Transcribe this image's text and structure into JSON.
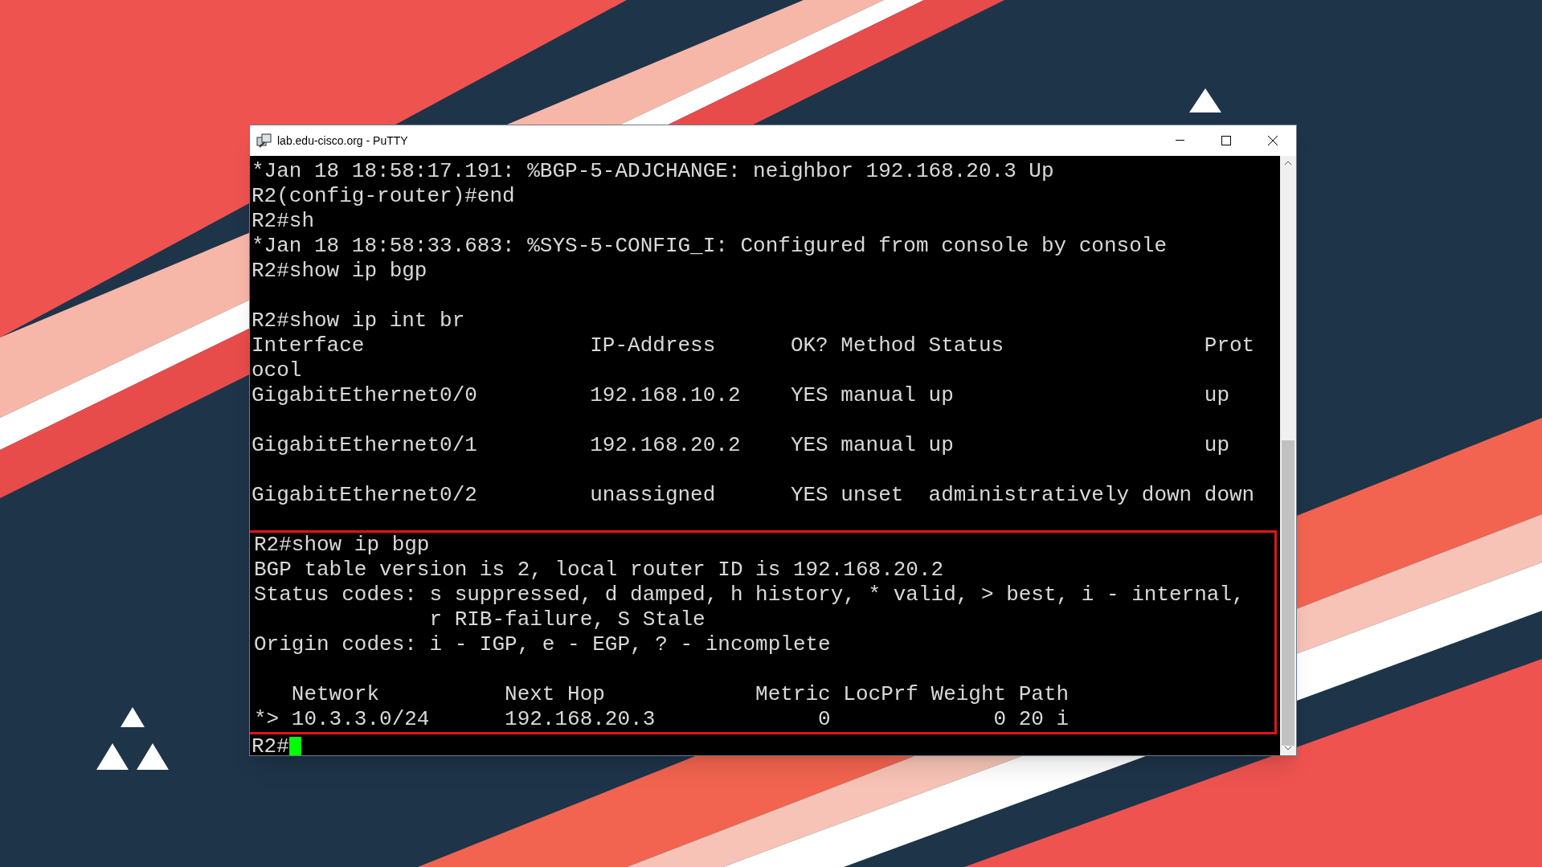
{
  "window": {
    "title": "lab.edu-cisco.org - PuTTY"
  },
  "terminal": {
    "lines": [
      {
        "kind": "text",
        "text": "*Jan 18 18:58:17.191: %BGP-5-ADJCHANGE: neighbor 192.168.20.3 Up"
      },
      {
        "kind": "text",
        "text": "R2(config-router)#end"
      },
      {
        "kind": "text",
        "text": "R2#sh"
      },
      {
        "kind": "text",
        "text": "*Jan 18 18:58:33.683: %SYS-5-CONFIG_I: Configured from console by console"
      },
      {
        "kind": "text",
        "text": "R2#show ip bgp"
      },
      {
        "kind": "blank"
      },
      {
        "kind": "text",
        "text": "R2#show ip int br"
      },
      {
        "kind": "text",
        "text": "Interface                  IP-Address      OK? Method Status                Prot"
      },
      {
        "kind": "text",
        "text": "ocol"
      },
      {
        "kind": "text",
        "text": "GigabitEthernet0/0         192.168.10.2    YES manual up                    up"
      },
      {
        "kind": "blank"
      },
      {
        "kind": "text",
        "text": "GigabitEthernet0/1         192.168.20.2    YES manual up                    up"
      },
      {
        "kind": "blank"
      },
      {
        "kind": "text",
        "text": "GigabitEthernet0/2         unassigned      YES unset  administratively down down"
      },
      {
        "kind": "blank"
      }
    ],
    "highlighted_lines": [
      {
        "kind": "text",
        "text": "R2#show ip bgp"
      },
      {
        "kind": "text",
        "text": "BGP table version is 2, local router ID is 192.168.20.2"
      },
      {
        "kind": "text",
        "text": "Status codes: s suppressed, d damped, h history, * valid, > best, i - internal,"
      },
      {
        "kind": "text",
        "text": "              r RIB-failure, S Stale"
      },
      {
        "kind": "text",
        "text": "Origin codes: i - IGP, e - EGP, ? - incomplete"
      },
      {
        "kind": "blank"
      },
      {
        "kind": "text",
        "text": "   Network          Next Hop            Metric LocPrf Weight Path"
      },
      {
        "kind": "text",
        "text": "*> 10.3.3.0/24      192.168.20.3             0             0 20 i"
      }
    ],
    "prompt": "R2#"
  }
}
